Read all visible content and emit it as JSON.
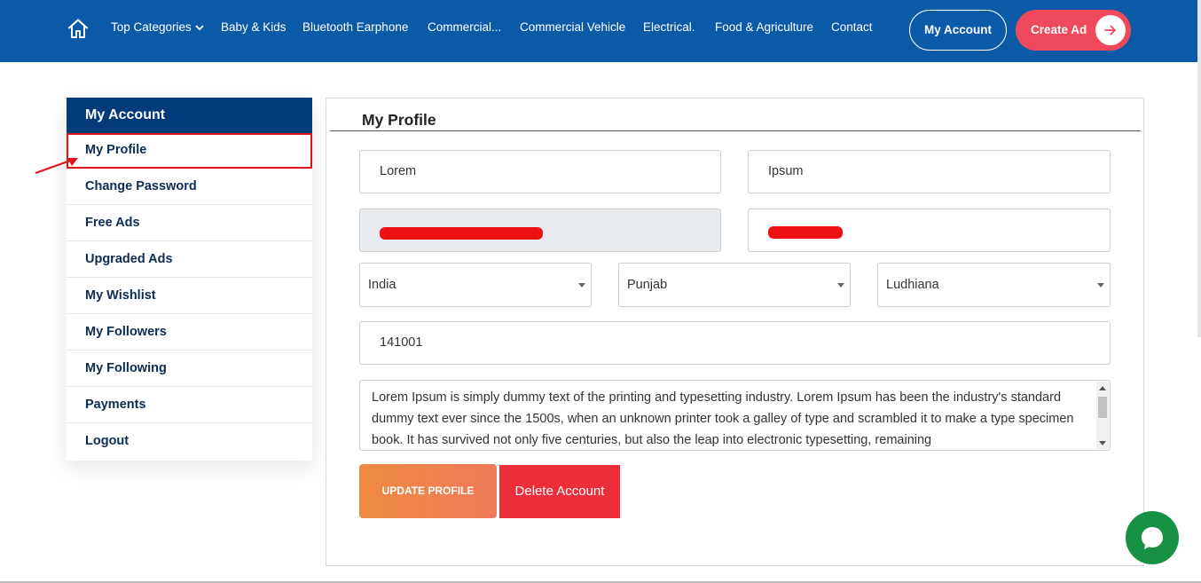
{
  "nav": {
    "home_icon": "home-icon",
    "items": [
      {
        "label": "Top Categories",
        "has_dropdown": true
      },
      {
        "label": "Baby & Kids"
      },
      {
        "label": "Bluetooth Earphone"
      },
      {
        "label": "Commercial..."
      },
      {
        "label": "Commercial Vehicle"
      },
      {
        "label": "Electrical."
      },
      {
        "label": "Food & Agriculture"
      },
      {
        "label": "Contact"
      }
    ],
    "my_account_label": "My Account",
    "create_ad_label": "Create Ad",
    "create_ad_icon": "arrow-right-icon"
  },
  "sidebar": {
    "title": "My Account",
    "items": [
      {
        "label": "My Profile",
        "active": true
      },
      {
        "label": "Change Password"
      },
      {
        "label": "Free Ads"
      },
      {
        "label": "Upgraded Ads"
      },
      {
        "label": "My Wishlist"
      },
      {
        "label": "My Followers"
      },
      {
        "label": "My Following"
      },
      {
        "label": "Payments"
      },
      {
        "label": "Logout"
      }
    ]
  },
  "profile": {
    "title": "My Profile",
    "first_name": "Lorem",
    "last_name": "Ipsum",
    "country": "India",
    "state": "Punjab",
    "city": "Ludhiana",
    "pincode": "141001",
    "about": "Lorem Ipsum is simply dummy text of the printing and typesetting industry. Lorem Ipsum has been the industry's standard dummy text ever since the 1500s, when an unknown printer took a galley of type and scrambled it to make a type specimen book. It has survived not only five centuries, but also the leap into electronic typesetting, remaining",
    "update_label": "UPDATE PROFILE",
    "delete_label": "Delete Account"
  },
  "colors": {
    "nav_bg": "#0b5aa8",
    "sidebar_head": "#033a7a",
    "create_ad": "#ef4a5c",
    "delete": "#ee2d3b",
    "update_from": "#ee8a42",
    "update_to": "#f07a58",
    "annotation": "#e0121c",
    "chat": "#179144"
  },
  "chat_icon": "chat-bubble-icon"
}
